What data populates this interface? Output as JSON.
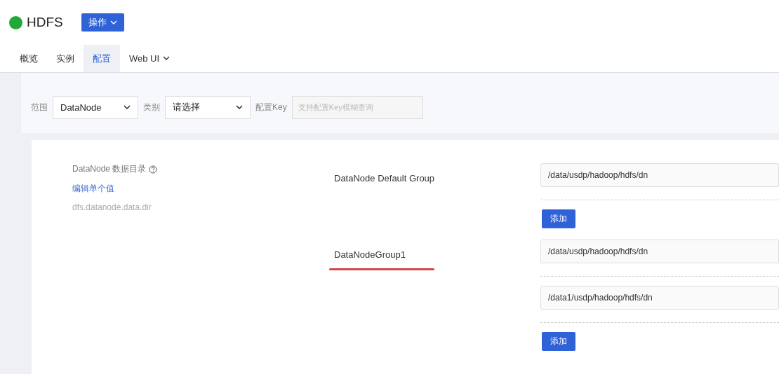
{
  "service": {
    "name": "HDFS",
    "color": "#22a838",
    "action_button": "操作"
  },
  "tabs": [
    {
      "label": "概览",
      "selected": false,
      "dropdown": false
    },
    {
      "label": "实例",
      "selected": false,
      "dropdown": false
    },
    {
      "label": "配置",
      "selected": true,
      "dropdown": false
    },
    {
      "label": "Web UI",
      "selected": false,
      "dropdown": true
    }
  ],
  "filters": [
    {
      "kind": "select",
      "label": "范围",
      "value": "DataNode"
    },
    {
      "kind": "select",
      "label": "类别",
      "value": "请选择"
    },
    {
      "kind": "text",
      "label": "配置Key",
      "placeholder": "支持配置Key模糊查询"
    }
  ],
  "config": {
    "title": "DataNode 数据目录",
    "edit_link": "编辑单个值",
    "key": "dfs.datanode.data.dir",
    "groups": [
      {
        "name": "DataNode Default Group",
        "underlined": false,
        "values": [
          "/data/usdp/hadoop/hdfs/dn"
        ],
        "add_button": "添加"
      },
      {
        "name": "DataNodeGroup1",
        "underlined": true,
        "values": [
          "/data/usdp/hadoop/hdfs/dn",
          "/data1/usdp/hadoop/hdfs/dn"
        ],
        "add_button": "添加"
      }
    ]
  }
}
